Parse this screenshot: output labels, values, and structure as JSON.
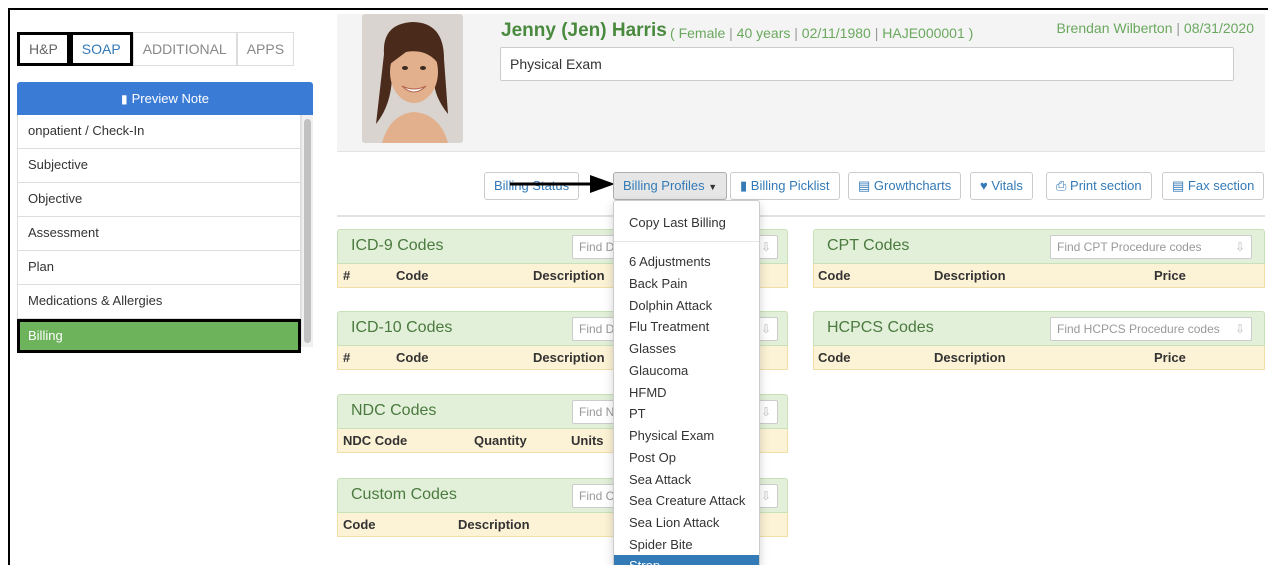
{
  "sidebar": {
    "tabs": [
      "H&P",
      "SOAP",
      "ADDITIONAL",
      "APPS"
    ],
    "preview_label": "Preview Note",
    "items": [
      "onpatient / Check-In",
      "Subjective",
      "Objective",
      "Assessment",
      "Plan",
      "Medications & Allergies",
      "Billing"
    ],
    "active_item": "Billing"
  },
  "patient": {
    "name": "Jenny (Jen) Harris",
    "gender": "Female",
    "age": "40 years",
    "dob": "02/11/1980",
    "chart_id": "HAJE000001",
    "provider": "Brendan Wilberton",
    "date": "08/31/2020",
    "note_title": "Physical Exam"
  },
  "toolbar": {
    "billing_status": "Billing Status",
    "billing_profiles": "Billing Profiles",
    "billing_picklist": "Billing Picklist",
    "growthcharts": "Growthcharts",
    "vitals": "Vitals",
    "print_section": "Print section",
    "fax_section": "Fax section"
  },
  "panels": {
    "icd9": {
      "title": "ICD-9 Codes",
      "find": "Find Diagnosis codes",
      "cols": [
        "#",
        "Code",
        "Description"
      ]
    },
    "icd10": {
      "title": "ICD-10 Codes",
      "find": "Find Diagnosis codes",
      "cols": [
        "#",
        "Code",
        "Description"
      ]
    },
    "ndc": {
      "title": "NDC Codes",
      "find": "Find NDC codes",
      "cols": [
        "NDC Code",
        "Quantity",
        "Units"
      ]
    },
    "custom": {
      "title": "Custom Codes",
      "find": "Find Custom codes",
      "cols": [
        "Code",
        "Description"
      ]
    },
    "cpt": {
      "title": "CPT Codes",
      "find": "Find CPT Procedure codes",
      "cols": [
        "Code",
        "Description",
        "Price"
      ]
    },
    "hcpcs": {
      "title": "HCPCS Codes",
      "find": "Find HCPCS Procedure codes",
      "cols": [
        "Code",
        "Description",
        "Price"
      ]
    }
  },
  "dropdown": {
    "first": "Copy Last Billing",
    "items": [
      "6 Adjustments",
      "Back Pain",
      "Dolphin Attack",
      "Flu Treatment",
      "Glasses",
      "Glaucoma",
      "HFMD",
      "PT",
      "Physical Exam",
      "Post Op",
      "Sea Attack",
      "Sea Creature Attack",
      "Sea Lion Attack",
      "Spider Bite",
      "Strep"
    ],
    "highlighted": "Strep"
  },
  "colors": {
    "accent_blue": "#337ab7",
    "active_green": "#6db35b",
    "panel_green": "#e2f0d9",
    "column_yellow": "#fcf2d5"
  }
}
